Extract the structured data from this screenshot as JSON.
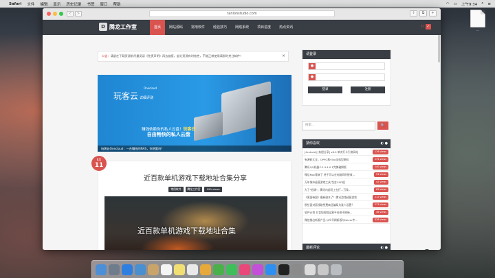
{
  "menubar": {
    "apple": "",
    "app": "Safari",
    "items": [
      "文件",
      "编辑",
      "显示",
      "历史记录",
      "书签",
      "窗口",
      "帮助"
    ],
    "time": "上午9:34"
  },
  "desktop_file": {
    "label": "..."
  },
  "browser": {
    "url": "tanlonstudio.com",
    "back": "<",
    "forward": ">"
  },
  "site": {
    "logo_mark": "D",
    "logo_text": "腾龙工作室",
    "nav": [
      "首页",
      "网站源码",
      "常用软件",
      "经验技巧",
      "网络系统",
      "项目进度",
      "热点资讯"
    ],
    "cart_count": "0"
  },
  "notice": {
    "prefix": "公告：",
    "text": "请留在下载资源前尽量阅读《免责声明》再去链接，部分资源有时效性，不能正常使用请即时关注邮件！",
    "close": "×"
  },
  "banner": {
    "title": "玩客云",
    "title_suffix": "详细评测",
    "title_small": "Onecloud",
    "sub_line1": "赚钱依赖你的私人云盘！",
    "sub_bold": "玩客云",
    "sub_line2": "自由畅快的私人云盘",
    "footer": "玩客云Onecloud：一台赚钱的NAS，你想要吗？"
  },
  "article": {
    "month": "8月",
    "day": "11",
    "title": "近百款单机游戏下载地址合集分享",
    "tags": [
      "常用软件",
      "腾龙工作室",
      "190 views"
    ],
    "image_title": "近百款单机游戏下载地址合集"
  },
  "login": {
    "title": "请登录",
    "user_icon": "●",
    "pass_icon": "●",
    "login_btn": "登录",
    "register_btn": "注册"
  },
  "search": {
    "placeholder": "搜索...",
    "icon": "🔍"
  },
  "hot": {
    "title": "猜你喜欢",
    "items": [
      {
        "text": "[Android] [有偿分享] v8.0 单次打卡引流网站",
        "views": "176 views"
      },
      {
        "text": "有源码大全，OPPO和Vivo全机型刷机",
        "views": "174 views"
      },
      {
        "text": "腾讯QQ机器人2.4.4.0.1完美破解版",
        "views": "240 views"
      },
      {
        "text": "微信Mac版来了 终于可以在电脑同时接收...",
        "views": "94 views"
      },
      {
        "text": "万年城市经营游戏工具 包含CAD组",
        "views": "42 views"
      },
      {
        "text": "为了\"低调\"，腾讯内部员工在打...万条...",
        "views": "65 views"
      },
      {
        "text": "《黑客帝国》最新剧本了！腾讯游戏经营游戏",
        "views": "212 views"
      },
      {
        "text": "那些面对面领取免费商品骗局为谁人设置？",
        "views": "213 views"
      },
      {
        "text": "软件计划 抖音短视频运营平台刷子刷新...",
        "views": "38 views"
      },
      {
        "text": "微信推出新版产品 公众号刷新版与Never中...",
        "views": "326 views"
      }
    ]
  },
  "recent": {
    "title": "最新评论"
  },
  "back_top": "⌃"
}
